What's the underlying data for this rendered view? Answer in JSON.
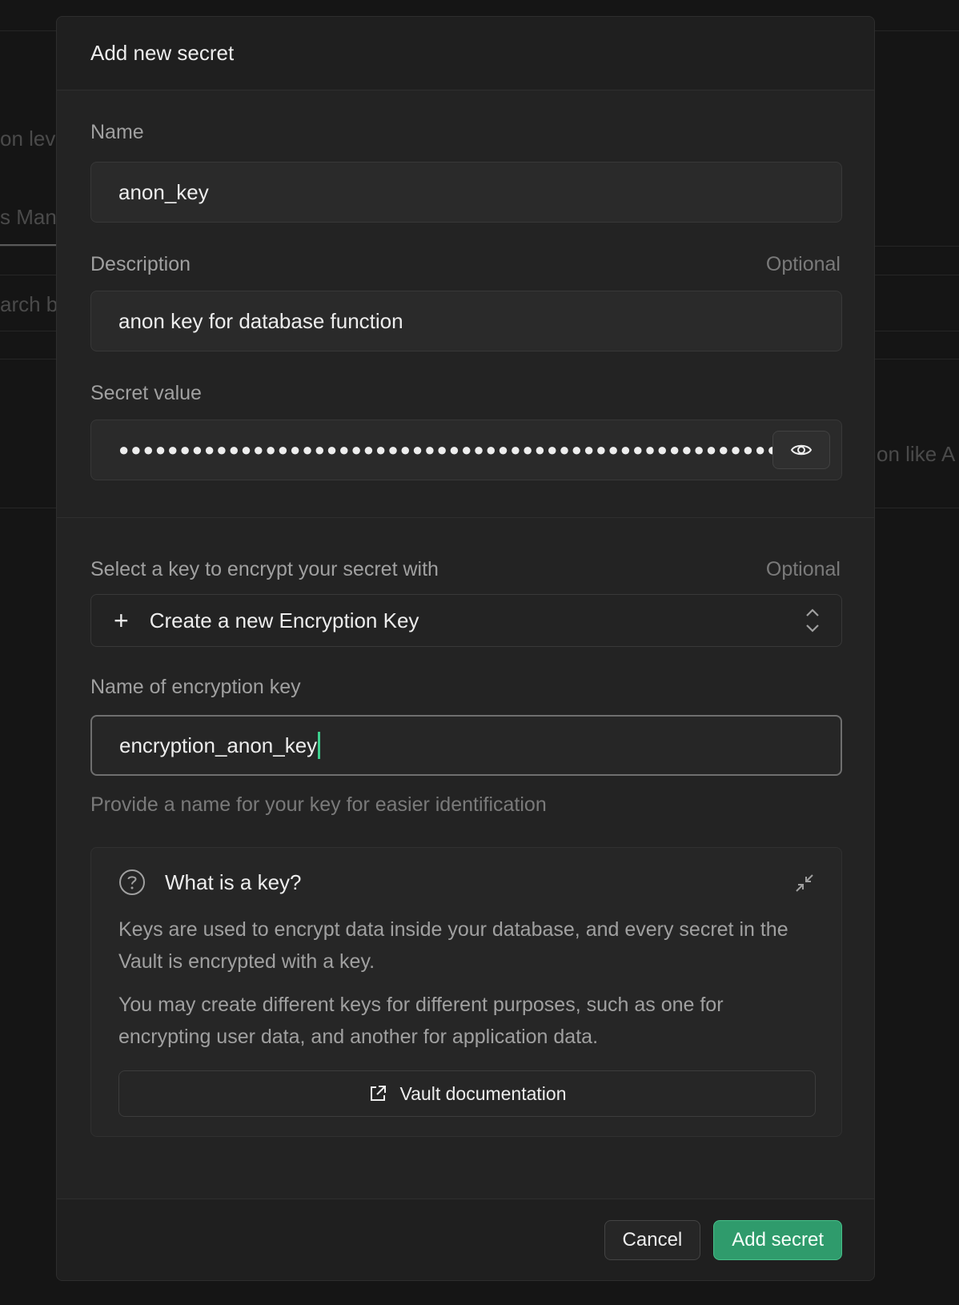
{
  "background": {
    "fragments": [
      "on lev",
      "s Man",
      "arch b",
      "on like A"
    ]
  },
  "modal": {
    "title": "Add new secret",
    "name_field": {
      "label": "Name",
      "value": "anon_key"
    },
    "description_field": {
      "label": "Description",
      "optional": "Optional",
      "value": "anon key for database function"
    },
    "secret_field": {
      "label": "Secret value",
      "masked_value": "●●●●●●●●●●●●●●●●●●●●●●●●●●●●●●●●●●●●●●●●●●●●●●●●●●●●●●●●●●●●●●●●●●●●●●●●"
    },
    "encryption_select": {
      "label": "Select a key to encrypt your secret with",
      "optional": "Optional",
      "value": "Create a new Encryption Key"
    },
    "key_name_field": {
      "label": "Name of encryption key",
      "value": "encryption_anon_key",
      "helper": "Provide a name for your key for easier identification"
    },
    "info": {
      "title": "What is a key?",
      "paragraph1": "Keys are used to encrypt data inside your database, and every secret in the Vault is encrypted with a key.",
      "paragraph2": "You may create different keys for different purposes, such as one for encrypting user data, and another for application data.",
      "doc_button": "Vault documentation"
    },
    "footer": {
      "cancel": "Cancel",
      "submit": "Add secret"
    }
  },
  "colors": {
    "accent": "#3ecf8e",
    "submit_bg": "#2f9b6c"
  }
}
